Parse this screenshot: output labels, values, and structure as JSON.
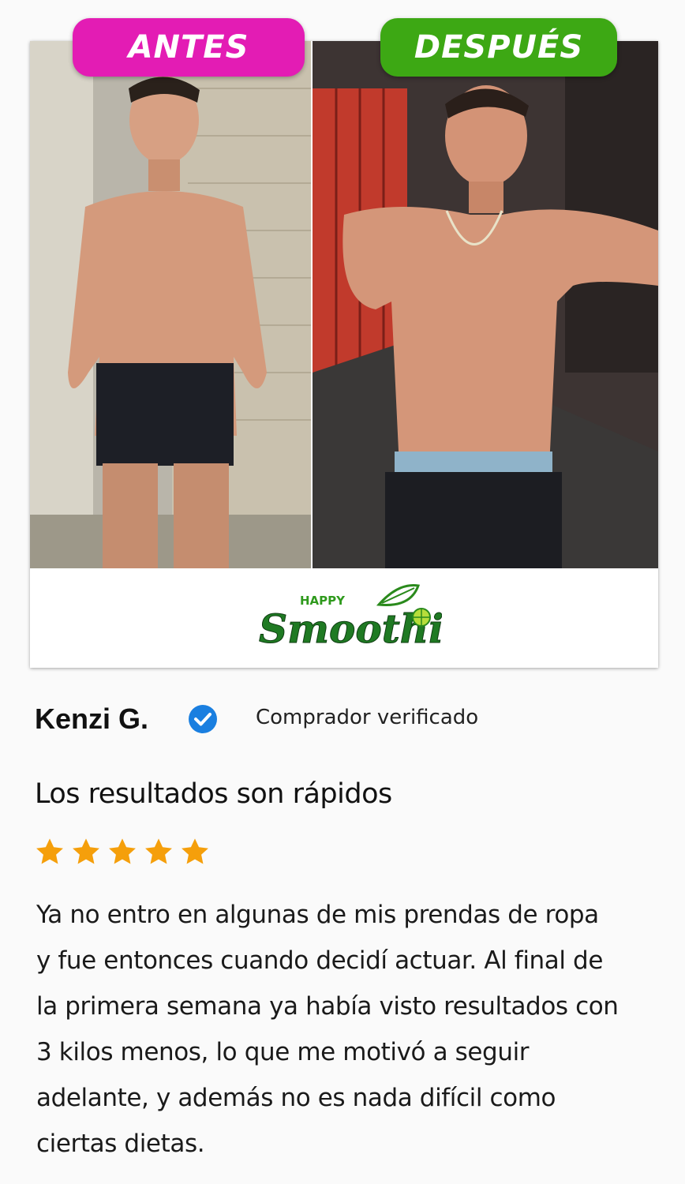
{
  "labels": {
    "before": "ANTES",
    "after": "DESPUÉS"
  },
  "brand": {
    "top": "HAPPY",
    "main": "Smoothie"
  },
  "reviewer": {
    "name": "Kenzi G.",
    "status": "Comprador verificado"
  },
  "review": {
    "title": "Los resultados son rápidos",
    "rating": 5,
    "body": "Ya no entro en algunas de mis prendas de ropa y fue entonces cuando decidí actuar. Al final de la primera semana ya había visto resultados con 3 kilos menos, lo que me motivó a seguir adelante, y además no es nada difícil como ciertas dietas."
  },
  "colors": {
    "before_accent": "#e31cb4",
    "after_accent": "#3da814",
    "brand_green": "#1f7a23",
    "star": "#f59f0b",
    "verified": "#1a7fe0"
  },
  "icons": {
    "verified": "check-badge-icon",
    "star": "star-icon",
    "leaf": "leaf-icon",
    "lime": "lime-slice-icon"
  }
}
